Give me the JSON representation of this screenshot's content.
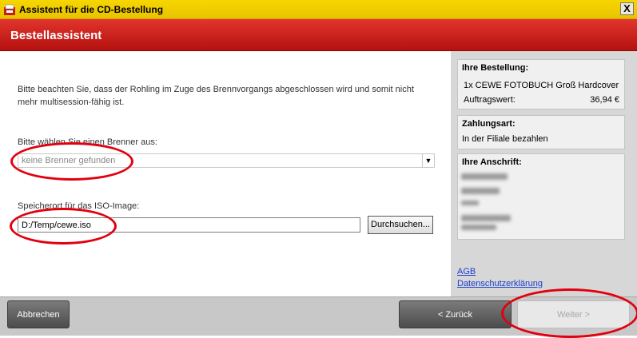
{
  "window": {
    "title": "Assistent für die CD-Bestellung",
    "close_label": "X"
  },
  "header": {
    "title": "Bestellassistent"
  },
  "main": {
    "notice": "Bitte beachten Sie, dass der Rohling im Zuge des Brennvorgangs abgeschlossen wird und somit nicht mehr multisession-fähig ist.",
    "burner_label": "Bitte wählen Sie einen Brenner aus:",
    "burner_value": "keine Brenner gefunden",
    "iso_label": "Speicherort für das ISO-Image:",
    "iso_value": "D:/Temp/cewe.iso",
    "browse_label": "Durchsuchen..."
  },
  "sidebar": {
    "order": {
      "title": "Ihre Bestellung:",
      "item": "1x CEWE FOTOBUCH Groß Hardcover",
      "value_label": "Auftragswert:",
      "value": "36,94 €"
    },
    "payment": {
      "title": "Zahlungsart:",
      "value": "In der Filiale bezahlen"
    },
    "address": {
      "title": "Ihre Anschrift:"
    },
    "links": {
      "agb": "AGB",
      "privacy": "Datenschutzerklärung"
    }
  },
  "footer": {
    "cancel": "Abbrechen",
    "back": "< Zurück",
    "next": "Weiter >"
  },
  "colors": {
    "titlebar": "#f6d600",
    "header": "#c51d19",
    "highlight": "#e2000f",
    "link": "#1a3fd0"
  }
}
